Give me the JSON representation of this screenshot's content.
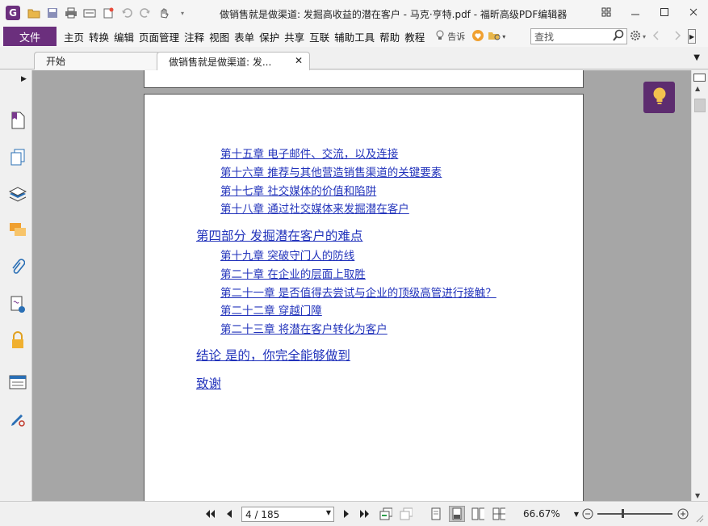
{
  "window": {
    "title": "做销售就是做渠道: 发掘高收益的潜在客户 - 马克·亨特.pdf - 福昕高级PDF编辑器",
    "logo_letter": "G"
  },
  "menubar": {
    "file_label": "文件",
    "items": [
      "主页",
      "转换",
      "编辑",
      "页面管理",
      "注释",
      "视图",
      "表单",
      "保护",
      "共享",
      "互联",
      "辅助工具",
      "帮助",
      "教程"
    ],
    "tell_label": "告诉",
    "search_placeholder": "查找"
  },
  "tabs": [
    {
      "label": "开始"
    },
    {
      "label": "做销售就是做渠道: 发...",
      "active": true
    }
  ],
  "document": {
    "toc": [
      {
        "text": "第十五章 电子邮件、交流，以及连接",
        "level": 2
      },
      {
        "text": "第十六章 推荐与其他营造销售渠道的关键要素",
        "level": 2
      },
      {
        "text": "第十七章 社交媒体的价值和陷阱",
        "level": 2
      },
      {
        "text": "第十八章 通过社交媒体来发掘潜在客户",
        "level": 2
      },
      {
        "text": "第四部分 发掘潜在客户的难点",
        "level": 1
      },
      {
        "text": "第十九章 突破守门人的防线",
        "level": 2
      },
      {
        "text": "第二十章 在企业的层面上取胜",
        "level": 2
      },
      {
        "text": "第二十一章 是否值得去尝试与企业的顶级高管进行接触？",
        "level": 2
      },
      {
        "text": "第二十二章 穿越门障",
        "level": 2
      },
      {
        "text": "第二十三章 将潜在客户转化为客户",
        "level": 2
      },
      {
        "text": "结论 是的，你完全能够做到",
        "level": 1
      },
      {
        "text": "致谢",
        "level": 1
      }
    ]
  },
  "statusbar": {
    "page_field": "4 / 185",
    "zoom": "66.67%"
  },
  "colors": {
    "brand": "#6b2f7d",
    "link": "#2233bb",
    "doc_background": "#a6a6a6"
  }
}
